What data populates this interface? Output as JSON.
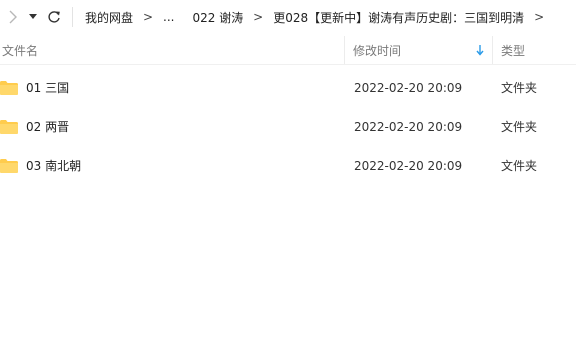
{
  "toolbar": {
    "forward_icon": "chevron-right-icon",
    "dropdown_icon": "caret-down-icon",
    "refresh_icon": "refresh-icon"
  },
  "breadcrumb": {
    "items": [
      "我的网盘",
      "...",
      "022 谢涛",
      "更028【更新中】谢涛有声历史剧：三国到明清"
    ],
    "separator": ">"
  },
  "columns": {
    "name": "文件名",
    "date": "修改时间",
    "type": "类型",
    "sort_icon": "sort-down-arrow-icon"
  },
  "files": [
    {
      "name": "01 三国",
      "date": "2022-02-20 20:09",
      "type": "文件夹",
      "icon": "folder-icon"
    },
    {
      "name": "02 两晋",
      "date": "2022-02-20 20:09",
      "type": "文件夹",
      "icon": "folder-icon"
    },
    {
      "name": "03 南北朝",
      "date": "2022-02-20 20:09",
      "type": "文件夹",
      "icon": "folder-icon"
    }
  ],
  "colors": {
    "folder": "#FFCC4D",
    "sort_arrow": "#2A9BE8",
    "header_text": "#7A7A7A"
  }
}
